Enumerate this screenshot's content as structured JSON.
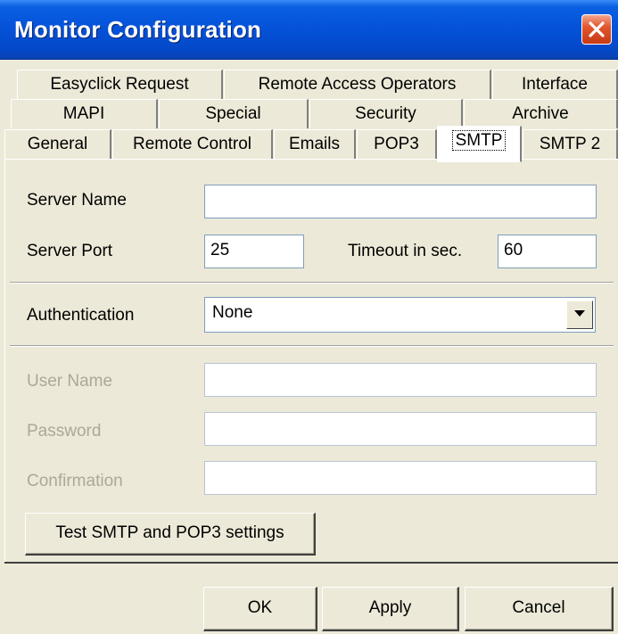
{
  "window": {
    "title": "Monitor Configuration"
  },
  "tabs": {
    "row1": [
      "Easyclick Request",
      "Remote Access Operators",
      "Interface"
    ],
    "row2": [
      "MAPI",
      "Special",
      "Security",
      "Archive"
    ],
    "row3": [
      "General",
      "Remote Control",
      "Emails",
      "POP3",
      "SMTP",
      "SMTP 2"
    ],
    "active": "SMTP"
  },
  "form": {
    "server_name_label": "Server Name",
    "server_name_value": "",
    "server_port_label": "Server Port",
    "server_port_value": "25",
    "timeout_label": "Timeout in sec.",
    "timeout_value": "60",
    "authentication_label": "Authentication",
    "authentication_value": "None",
    "user_name_label": "User Name",
    "password_label": "Password",
    "confirmation_label": "Confirmation",
    "test_button": "Test SMTP and POP3 settings"
  },
  "buttons": {
    "ok": "OK",
    "apply": "Apply",
    "cancel": "Cancel"
  },
  "icons": {
    "close": "close-icon",
    "dropdown": "chevron-down-icon"
  },
  "colors": {
    "titlebar": "#0553DA",
    "close": "#E2572F",
    "face": "#ECE9D8",
    "disabled_text": "#ACA899"
  }
}
